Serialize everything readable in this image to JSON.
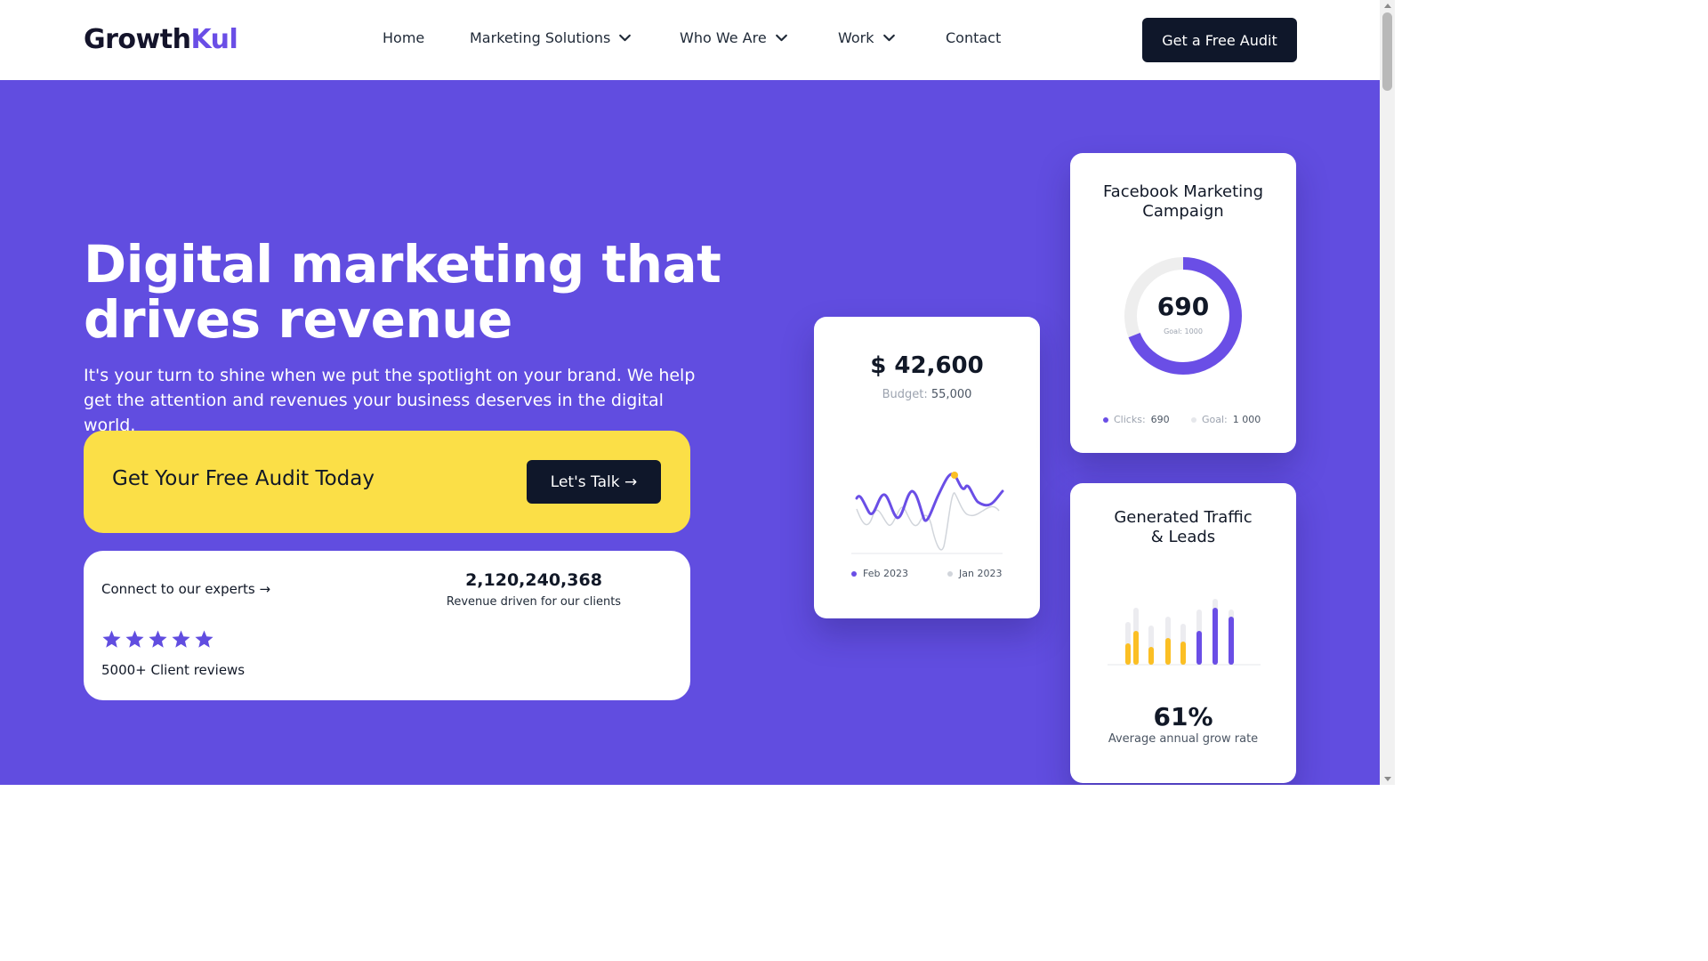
{
  "brand": {
    "name_part1": "Growth",
    "name_part2": "Kul",
    "accent_color": "#6a4ee6"
  },
  "nav": {
    "items": [
      {
        "label": "Home",
        "has_dropdown": false
      },
      {
        "label": "Marketing Solutions",
        "has_dropdown": true
      },
      {
        "label": "Who We Are",
        "has_dropdown": true
      },
      {
        "label": "Work",
        "has_dropdown": true
      },
      {
        "label": "Contact",
        "has_dropdown": false
      }
    ],
    "cta_label": "Get a Free Audit"
  },
  "hero": {
    "background_color": "#614de0",
    "headline_line1": "Digital marketing that",
    "headline_line2": "drives revenue",
    "subtext": "It's your turn to shine when we put the spotlight on your brand. We help get the attention and revenues your business deserves in the digital world.",
    "cta_text": "Get Your Free Audit Today",
    "cta_button": "Let's Talk →",
    "cta_color": "#fbdf47"
  },
  "stats": {
    "connect": "Connect to our experts →",
    "rating_stars": 5,
    "reviews": "5000+ Client reviews",
    "revenue_value": "2,120,240,368",
    "revenue_label": "Revenue driven for our clients"
  },
  "card_revenue": {
    "amount": "$ 42,600",
    "budget_label": "Budget:",
    "budget_value": "55,000",
    "legend_primary": "Feb 2023",
    "legend_secondary": "Jan 2023"
  },
  "card_facebook": {
    "title_line1": "Facebook Marketing",
    "title_line2": "Campaign",
    "value": "690",
    "goal_label": "Goal:",
    "goal_value": "1000",
    "clicks_label": "Clicks:",
    "clicks_value": "690",
    "legend_goal_label": "Goal:",
    "legend_goal_value": "1 000",
    "progress": 0.69
  },
  "card_traffic": {
    "title_line1": "Generated Traffic",
    "title_line2": "& Leads",
    "percent": "61%",
    "label": "Average annual grow rate"
  }
}
